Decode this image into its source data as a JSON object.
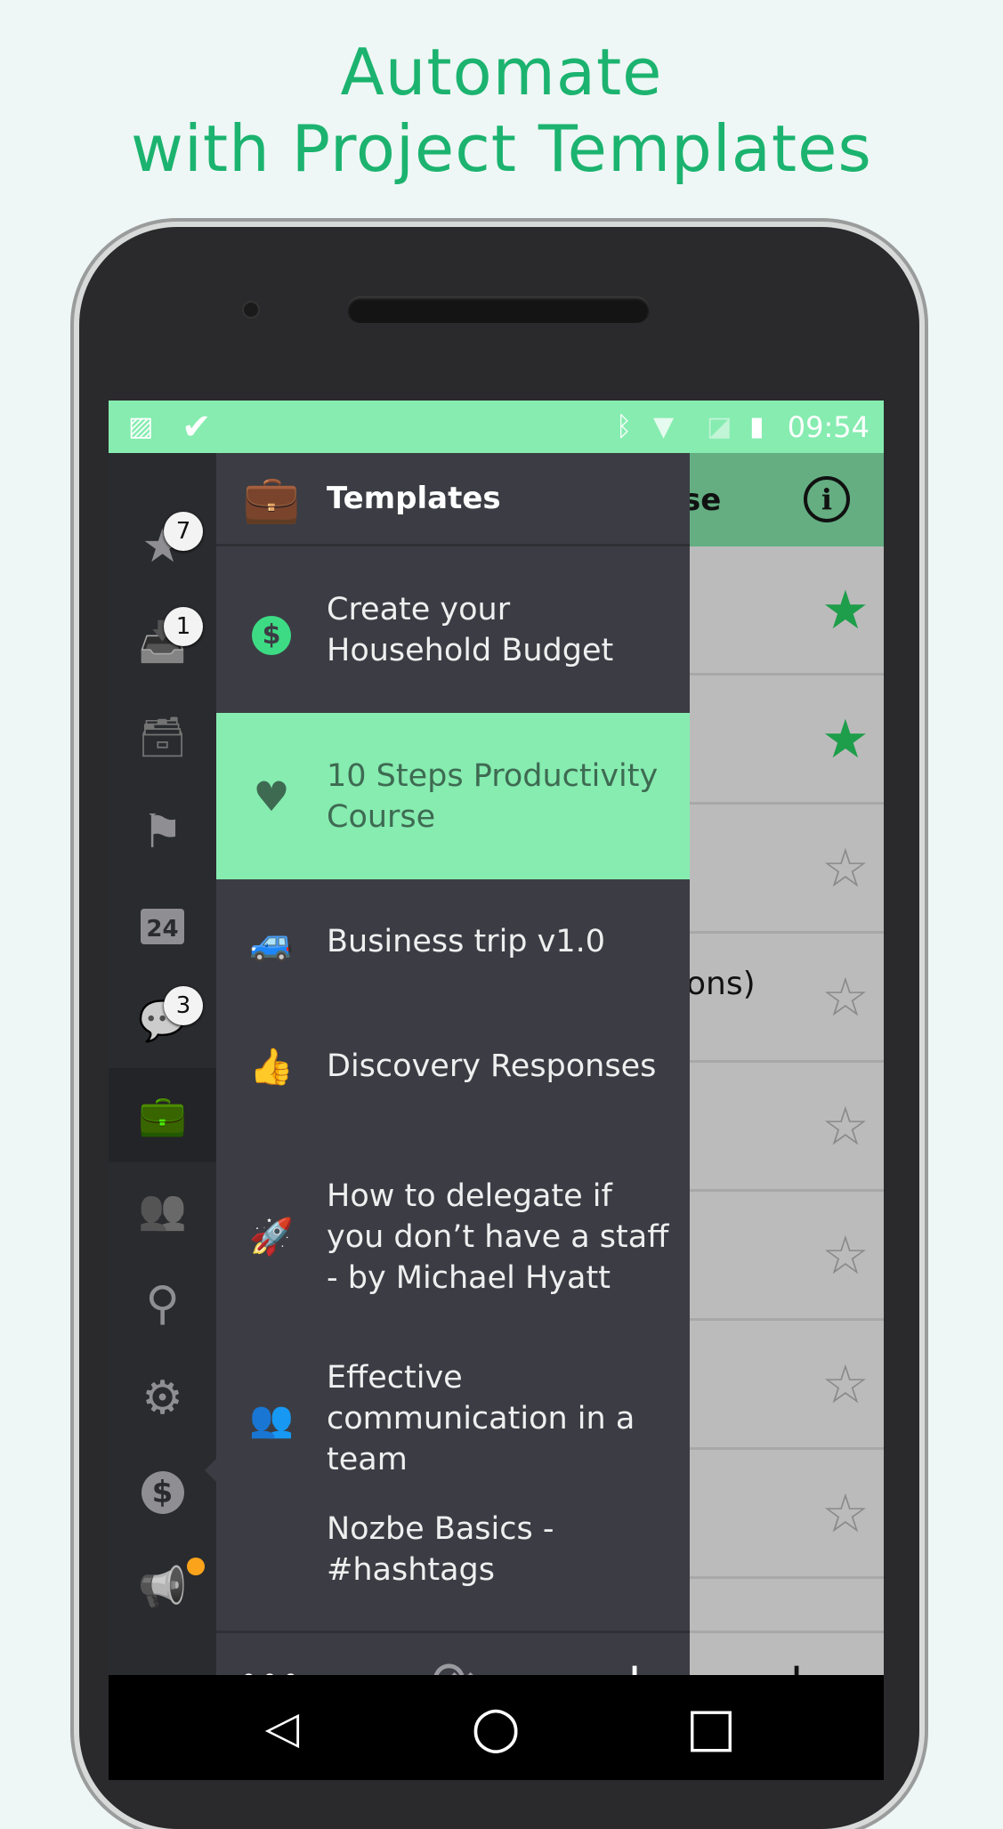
{
  "headline": {
    "line1": "Automate",
    "line2": "with Project Templates"
  },
  "status_bar": {
    "time": "09:54",
    "icons": [
      "image-icon",
      "check-circle-icon",
      "bluetooth-icon",
      "wifi-icon",
      "no-sim-icon",
      "battery-icon"
    ]
  },
  "sidebar": {
    "items": [
      {
        "icon": "star-icon",
        "glyph": "★",
        "badge": "7"
      },
      {
        "icon": "inbox-icon",
        "glyph": "📥",
        "badge": "1"
      },
      {
        "icon": "archive-icon",
        "glyph": "🗃",
        "badge": null
      },
      {
        "icon": "flag-icon",
        "glyph": "⚑",
        "badge": null
      },
      {
        "icon": "calendar-icon",
        "glyph": "24",
        "badge": null
      },
      {
        "icon": "comments-icon",
        "glyph": "💬",
        "badge": "3"
      },
      {
        "icon": "briefcase-icon",
        "glyph": "💼",
        "badge": null,
        "active": true
      },
      {
        "icon": "team-icon",
        "glyph": "👥",
        "badge": null
      },
      {
        "icon": "search-icon",
        "glyph": "⚲",
        "badge": null
      },
      {
        "icon": "gear-icon",
        "glyph": "⚙",
        "badge": null
      },
      {
        "icon": "money-icon",
        "glyph": "$",
        "badge": null
      },
      {
        "icon": "megaphone-icon",
        "glyph": "📢",
        "badge": null,
        "dot": "#fba41b"
      }
    ]
  },
  "drawer": {
    "title": "Templates",
    "items": [
      {
        "label": "Create your Household Budget",
        "icon": "dollar-icon",
        "color": "#3ddc84"
      },
      {
        "label": "10 Steps Productivity Course",
        "icon": "heart-icon",
        "color": "#3e6a52",
        "selected": true
      },
      {
        "label": "Business trip v1.0",
        "icon": "car-icon",
        "color": "#7fd6f2"
      },
      {
        "label": "Discovery Responses",
        "icon": "thumbs-up-icon",
        "color": "#d9703a"
      },
      {
        "label": "How to delegate if you don’t have a staff - by Michael Hyatt",
        "icon": "rocket-icon",
        "color": "#c8dc2c"
      },
      {
        "label": "Effective communication in a team",
        "icon": "people-icon",
        "color": "#7be8b4"
      },
      {
        "label": "Nozbe Basics - #hashtags",
        "icon": "none",
        "color": ""
      }
    ],
    "bottom": {
      "more": "•••",
      "sync": "⟳",
      "add": "+"
    }
  },
  "right_pane": {
    "header_fragment": "se",
    "row_fragment": "ons)",
    "stars": [
      true,
      true,
      false,
      false,
      false,
      false,
      false,
      false
    ],
    "add": "+",
    "star_color": "#1e9e4a"
  },
  "navbar": {
    "back": "◁",
    "home": "○",
    "recents": "□"
  }
}
